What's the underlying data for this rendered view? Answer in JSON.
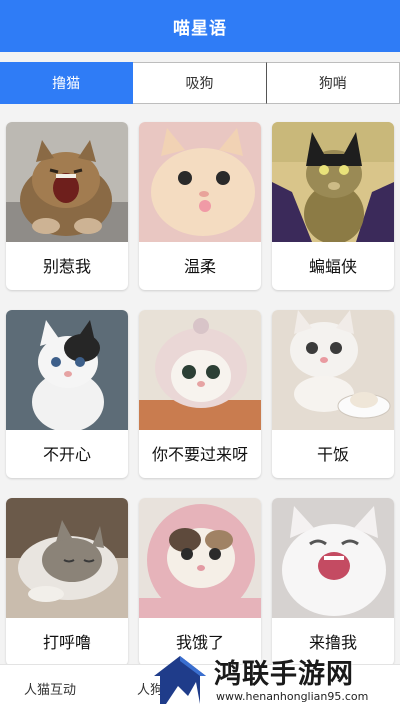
{
  "header": {
    "title": "喵星语"
  },
  "tabs": [
    {
      "label": "撸猫",
      "active": true
    },
    {
      "label": "吸狗",
      "active": false
    },
    {
      "label": "狗哨",
      "active": false
    }
  ],
  "cards": [
    {
      "caption": "别惹我",
      "image": "yawning-tabby-cat"
    },
    {
      "caption": "温柔",
      "image": "cream-kitten-closeup"
    },
    {
      "caption": "蝙蝠侠",
      "image": "cat-with-batman-mask"
    },
    {
      "caption": "不开心",
      "image": "white-black-kitten"
    },
    {
      "caption": "你不要过来呀",
      "image": "kitten-in-hood"
    },
    {
      "caption": "干饭",
      "image": "kitten-with-bowl"
    },
    {
      "caption": "打呼噜",
      "image": "sleeping-kitten"
    },
    {
      "caption": "我饿了",
      "image": "kitten-in-pink-towel"
    },
    {
      "caption": "来撸我",
      "image": "laughing-white-kitten"
    }
  ],
  "bottom_nav": [
    {
      "label": "人猫互动"
    },
    {
      "label": "人狗"
    }
  ],
  "watermark": {
    "brand": "鸿联手游网",
    "url": "www.henanhonglian95.com"
  },
  "colors": {
    "primary": "#2f7cf6",
    "background": "#f3f3f3"
  }
}
